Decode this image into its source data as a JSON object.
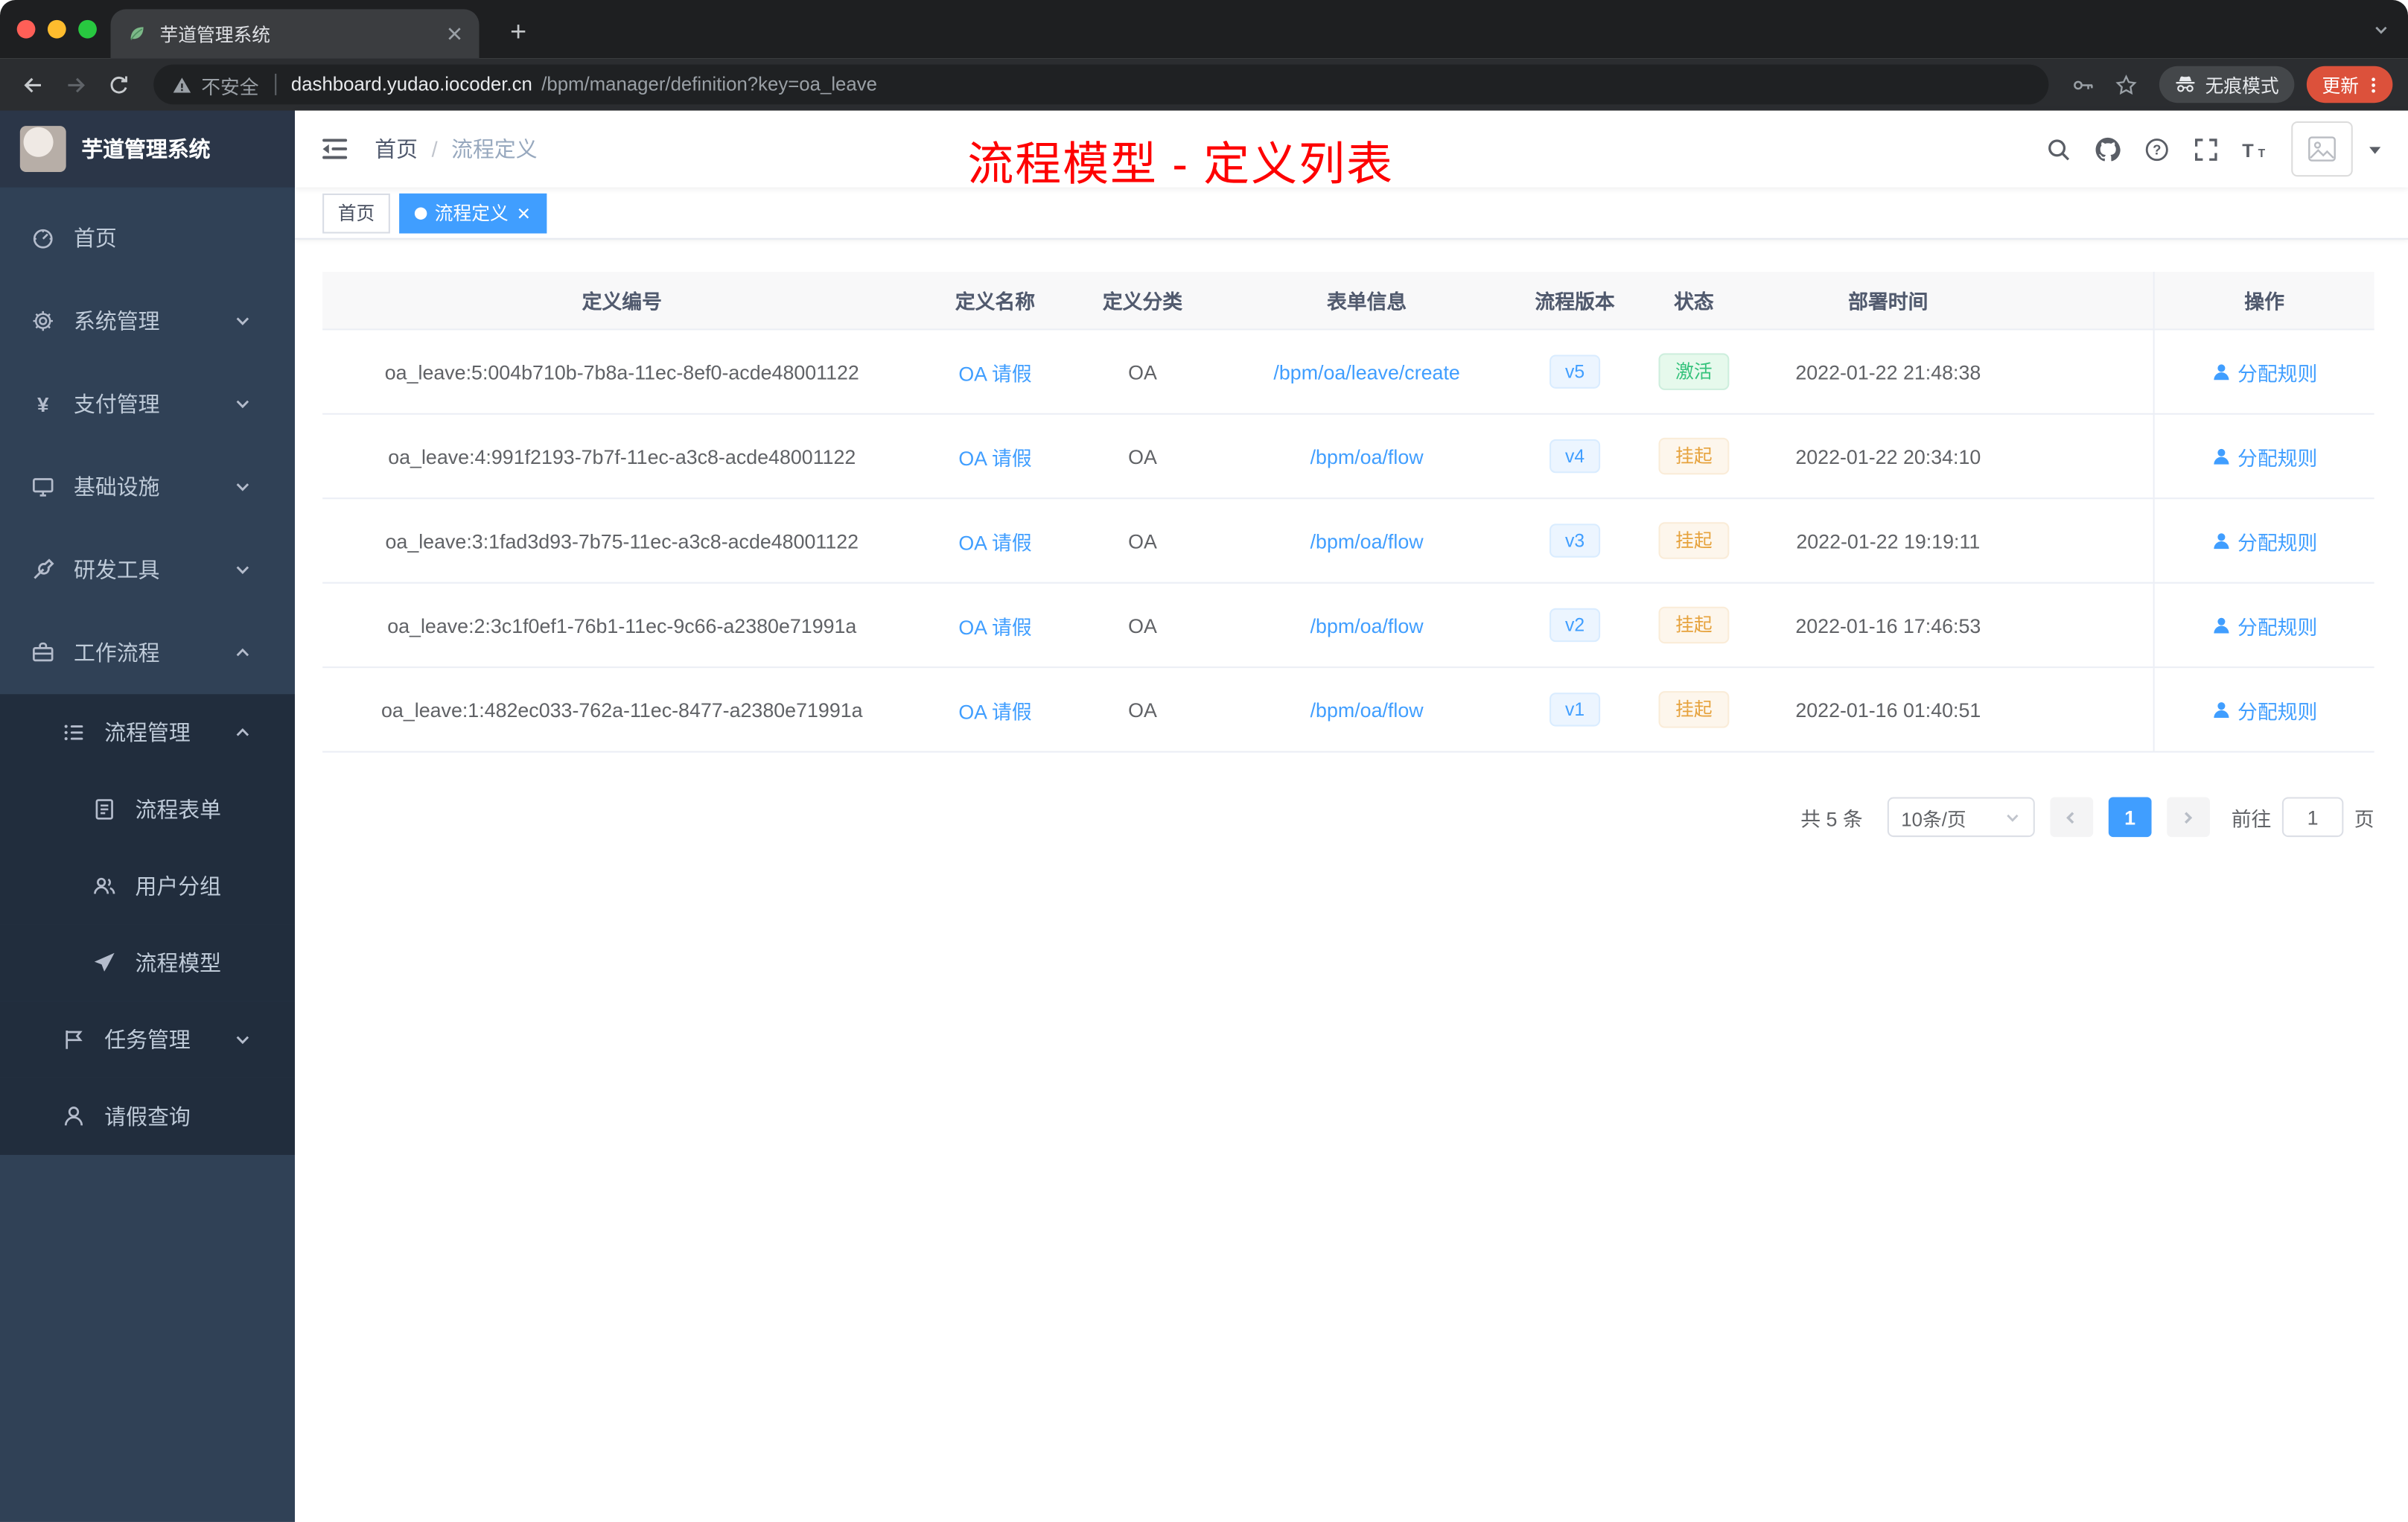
{
  "browser": {
    "tab_title": "芋道管理系统",
    "security_label": "不安全",
    "url_host": "dashboard.yudao.iocoder.cn",
    "url_path": "/bpm/manager/definition?key=oa_leave",
    "incognito_label": "无痕模式",
    "update_label": "更新"
  },
  "sidebar": {
    "logo_title": "芋道管理系统",
    "menu": [
      {
        "key": "home",
        "label": "首页",
        "icon": "dashboard-icon",
        "level": 1
      },
      {
        "key": "system",
        "label": "系统管理",
        "icon": "gear-icon",
        "level": 1,
        "chevron": "down"
      },
      {
        "key": "payment",
        "label": "支付管理",
        "icon": "yen-icon",
        "level": 1,
        "chevron": "down"
      },
      {
        "key": "infrastructure",
        "label": "基础设施",
        "icon": "monitor-icon",
        "level": 1,
        "chevron": "down"
      },
      {
        "key": "devtools",
        "label": "研发工具",
        "icon": "tool-icon",
        "level": 1,
        "chevron": "down"
      },
      {
        "key": "workflow",
        "label": "工作流程",
        "icon": "briefcase-icon",
        "level": 1,
        "chevron": "up"
      },
      {
        "key": "process-mgmt",
        "label": "流程管理",
        "icon": "list-icon",
        "level": 2,
        "chevron": "up"
      },
      {
        "key": "process-form",
        "label": "流程表单",
        "icon": "doc-icon",
        "level": 3
      },
      {
        "key": "user-group",
        "label": "用户分组",
        "icon": "users-icon",
        "level": 3
      },
      {
        "key": "process-model",
        "label": "流程模型",
        "icon": "send-icon",
        "level": 3
      },
      {
        "key": "task-mgmt",
        "label": "任务管理",
        "icon": "task-icon",
        "level": 2,
        "chevron": "down"
      },
      {
        "key": "leave-query",
        "label": "请假查询",
        "icon": "user-icon",
        "level": 2
      }
    ]
  },
  "navbar": {
    "breadcrumb": [
      {
        "label": "首页"
      },
      {
        "label": "流程定义"
      }
    ],
    "breadcrumb_separator": "/",
    "overlay_title": "流程模型 - 定义列表"
  },
  "tags": [
    {
      "label": "首页",
      "active": false,
      "closable": false
    },
    {
      "label": "流程定义",
      "active": true,
      "closable": true
    }
  ],
  "table": {
    "columns": [
      "定义编号",
      "定义名称",
      "定义分类",
      "表单信息",
      "流程版本",
      "状态",
      "部署时间",
      "操作"
    ],
    "rows": [
      {
        "id": "oa_leave:5:004b710b-7b8a-11ec-8ef0-acde48001122",
        "name": "OA 请假",
        "category": "OA",
        "form": "/bpm/oa/leave/create",
        "version": "v5",
        "status": "激活",
        "status_type": "success",
        "deploy_time": "2022-01-22 21:48:38",
        "action": "分配规则"
      },
      {
        "id": "oa_leave:4:991f2193-7b7f-11ec-a3c8-acde48001122",
        "name": "OA 请假",
        "category": "OA",
        "form": "/bpm/oa/flow",
        "version": "v4",
        "status": "挂起",
        "status_type": "warning",
        "deploy_time": "2022-01-22 20:34:10",
        "action": "分配规则"
      },
      {
        "id": "oa_leave:3:1fad3d93-7b75-11ec-a3c8-acde48001122",
        "name": "OA 请假",
        "category": "OA",
        "form": "/bpm/oa/flow",
        "version": "v3",
        "status": "挂起",
        "status_type": "warning",
        "deploy_time": "2022-01-22 19:19:11",
        "action": "分配规则"
      },
      {
        "id": "oa_leave:2:3c1f0ef1-76b1-11ec-9c66-a2380e71991a",
        "name": "OA 请假",
        "category": "OA",
        "form": "/bpm/oa/flow",
        "version": "v2",
        "status": "挂起",
        "status_type": "warning",
        "deploy_time": "2022-01-16 17:46:53",
        "action": "分配规则"
      },
      {
        "id": "oa_leave:1:482ec033-762a-11ec-8477-a2380e71991a",
        "name": "OA 请假",
        "category": "OA",
        "form": "/bpm/oa/flow",
        "version": "v1",
        "status": "挂起",
        "status_type": "warning",
        "deploy_time": "2022-01-16 01:40:51",
        "action": "分配规则"
      }
    ]
  },
  "pagination": {
    "total_label": "共 5 条",
    "page_size_label": "10条/页",
    "current_page": "1",
    "goto_prefix": "前往",
    "goto_value": "1",
    "goto_suffix": "页"
  },
  "colors": {
    "accent_blue": "#409eff",
    "success_green": "#34c27b",
    "warning_orange": "#e6a23c",
    "title_red": "#fe0000",
    "sidebar_bg": "#304156",
    "submenu_bg": "#212d3d",
    "update_button": "#dc513b"
  }
}
